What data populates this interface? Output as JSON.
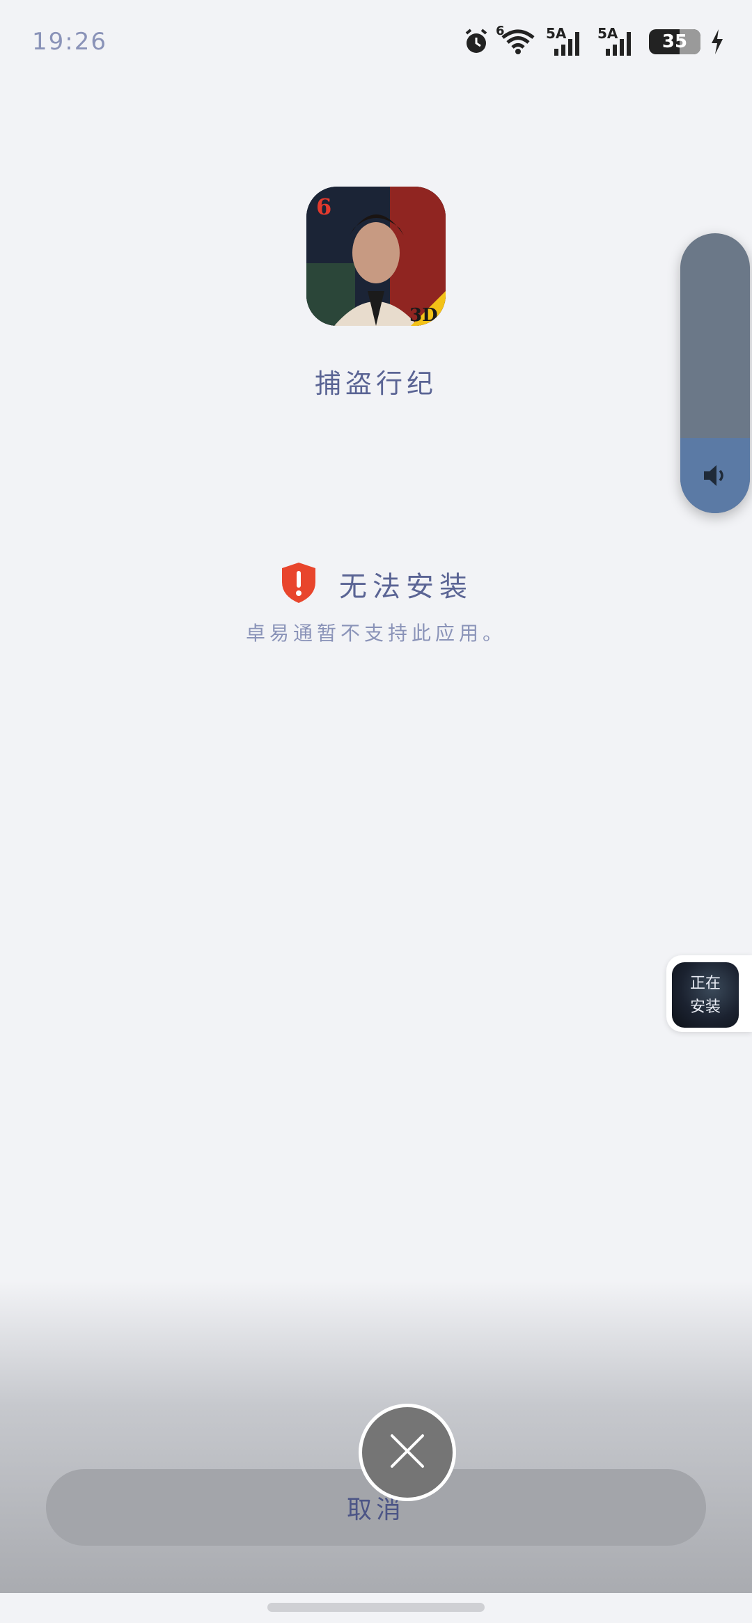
{
  "status_bar": {
    "time": "19:26",
    "signal1_label": "5A",
    "signal2_label": "5A",
    "wifi_label": "6",
    "battery": "35"
  },
  "app": {
    "name": "捕盗行纪",
    "icon_badge": "3D",
    "icon_corner": "6"
  },
  "error": {
    "title": "无法安装",
    "message": "卓易通暂不支持此应用。"
  },
  "float_bubble": {
    "line1": "正在",
    "line2": "安装"
  },
  "actions": {
    "cancel_label": "取消"
  },
  "icons": {
    "alarm": "alarm-icon",
    "wifi": "wifi-icon",
    "shield": "shield-warning-icon",
    "speaker": "speaker-icon",
    "close": "close-icon"
  },
  "colors": {
    "error_red": "#e8452c",
    "text_primary": "#5a6494",
    "volume_active": "#5b7aa5"
  }
}
